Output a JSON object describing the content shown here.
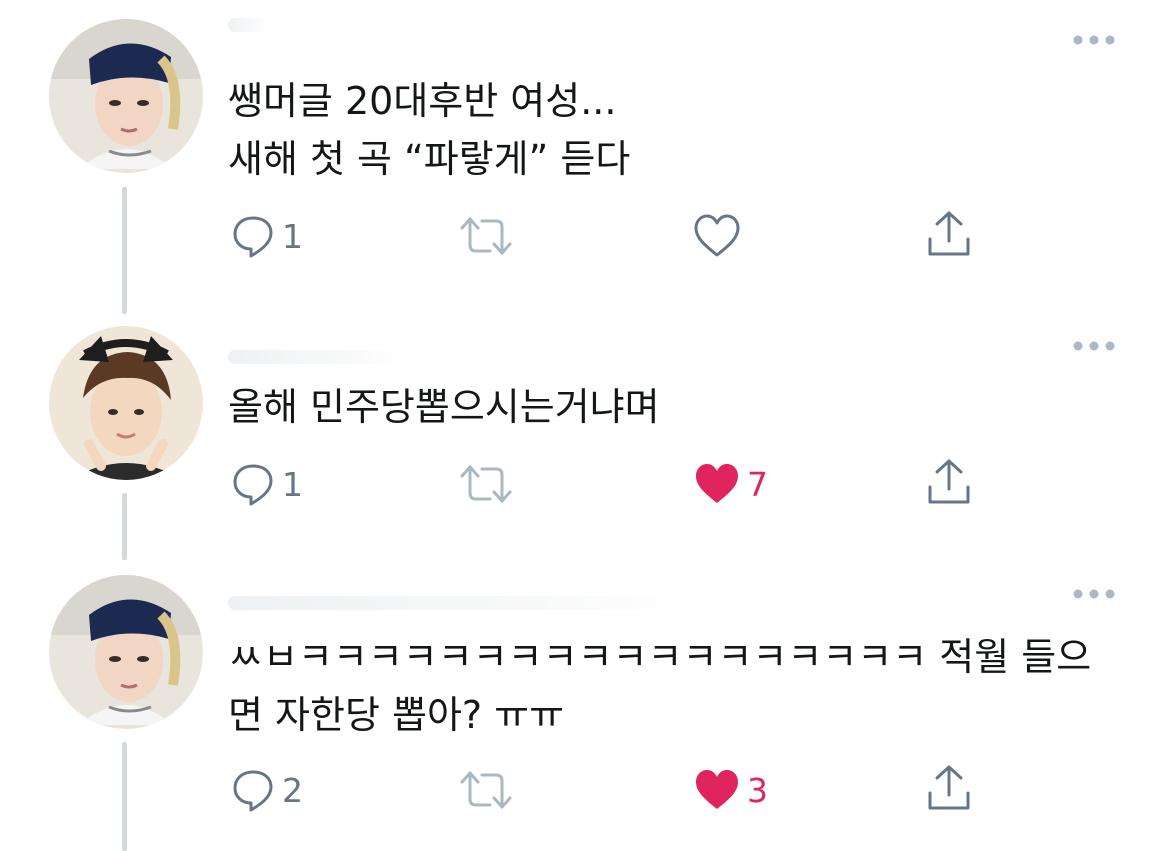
{
  "tweets": [
    {
      "text": "쌩머글 20대후반 여성...\n새해 첫 곡 “파랗게” 듣다",
      "reply_count": "1",
      "retweet_count": "",
      "like_count": "",
      "liked": false,
      "avatar": "avatar-blue-bandana",
      "icons": [
        "comment-icon",
        "retweet-icon",
        "heart-outline-icon",
        "share-icon",
        "more-icon"
      ]
    },
    {
      "text": "올해 민주당뽑으시는거냐며",
      "reply_count": "1",
      "retweet_count": "",
      "like_count": "7",
      "liked": true,
      "avatar": "avatar-brown-hair-cat-ears",
      "icons": [
        "comment-icon",
        "retweet-icon",
        "heart-filled-icon",
        "share-icon",
        "more-icon"
      ]
    },
    {
      "text": "ㅆㅂㅋㅋㅋㅋㅋㅋㅋㅋㅋㅋㅋㅋㅋㅋㅋㅋㅋㅋ 적월 들으\n면 자한당 뽑아? ㅠㅠ",
      "reply_count": "2",
      "retweet_count": "",
      "like_count": "3",
      "liked": true,
      "avatar": "avatar-blue-bandana",
      "icons": [
        "comment-icon",
        "retweet-icon",
        "heart-filled-icon",
        "share-icon",
        "more-icon"
      ]
    }
  ],
  "colors": {
    "icon_gray": "#657786",
    "icon_light": "#aab8c2",
    "like_red": "#e0245e",
    "thread_line": "#cfd9de",
    "text": "#14171a"
  }
}
